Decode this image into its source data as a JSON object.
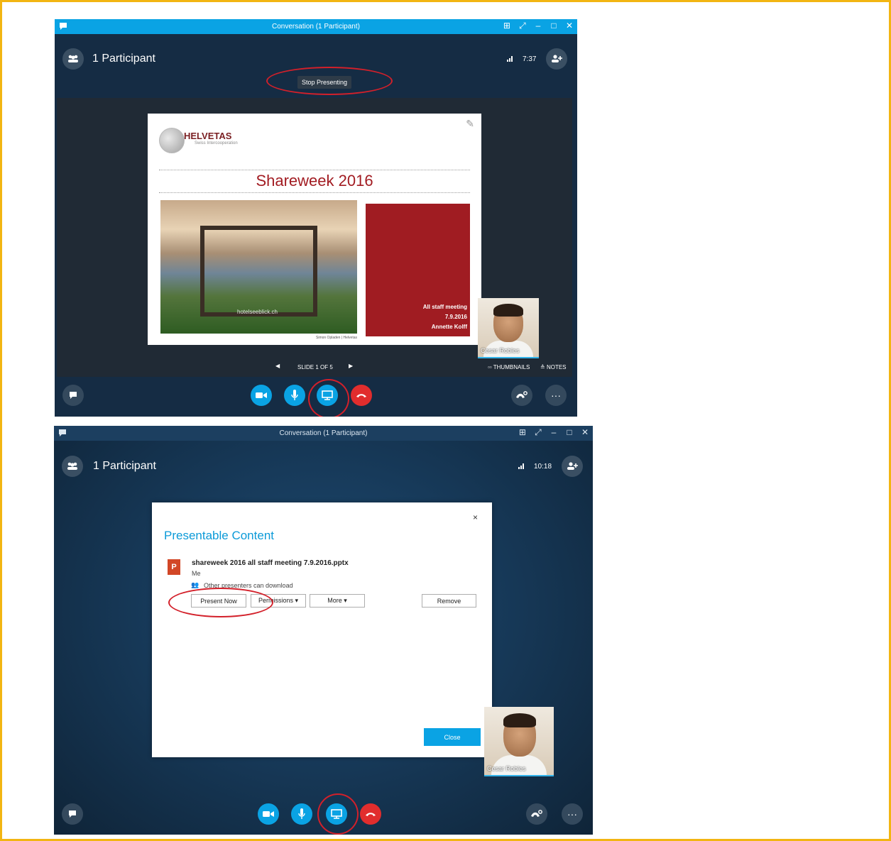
{
  "window1": {
    "title": "Conversation (1 Participant)",
    "participants": "1 Participant",
    "time": "7:37",
    "tooltip": "Stop Presenting",
    "slide": {
      "logo": "HELVETAS",
      "logo_sub": "Swiss Intercooperation",
      "title": "Shareweek 2016",
      "watermark": "hotelseeblick.ch",
      "credit": "Simon Opladen | Helvetas",
      "info_line1": "All staff meeting",
      "info_line2": "7.9.2016",
      "info_line3": "Annette Kolff"
    },
    "video_name": "Cesar Robles",
    "slide_counter": "SLIDE 1 OF 5",
    "thumbnails": "THUMBNAILS",
    "notes": "NOTES"
  },
  "window2": {
    "title": "Conversation (1 Participant)",
    "participants": "1 Participant",
    "time": "10:18",
    "dialog": {
      "title": "Presentable Content",
      "close_x": "×",
      "file_name": "shareweek 2016 all staff meeting 7.9.2016.pptx",
      "owner": "Me",
      "permission": "Other presenters can download",
      "present_now": "Present Now",
      "permissions": "Permissions ▾",
      "more": "More ▾",
      "remove": "Remove",
      "close": "Close"
    },
    "video_name": "Cesar Robles"
  },
  "colors": {
    "accent": "#0aa3e4",
    "hangup": "#e12d2d",
    "highlight_ring": "#d3202a",
    "page_border": "#f2b512"
  },
  "icons": [
    "chat-icon",
    "participants-icon",
    "add-person-icon",
    "video-icon",
    "microphone-icon",
    "present-screen-icon",
    "hang-up-icon",
    "call-controls-icon",
    "more-options-icon",
    "signal-icon",
    "powerpoint-file-icon"
  ]
}
